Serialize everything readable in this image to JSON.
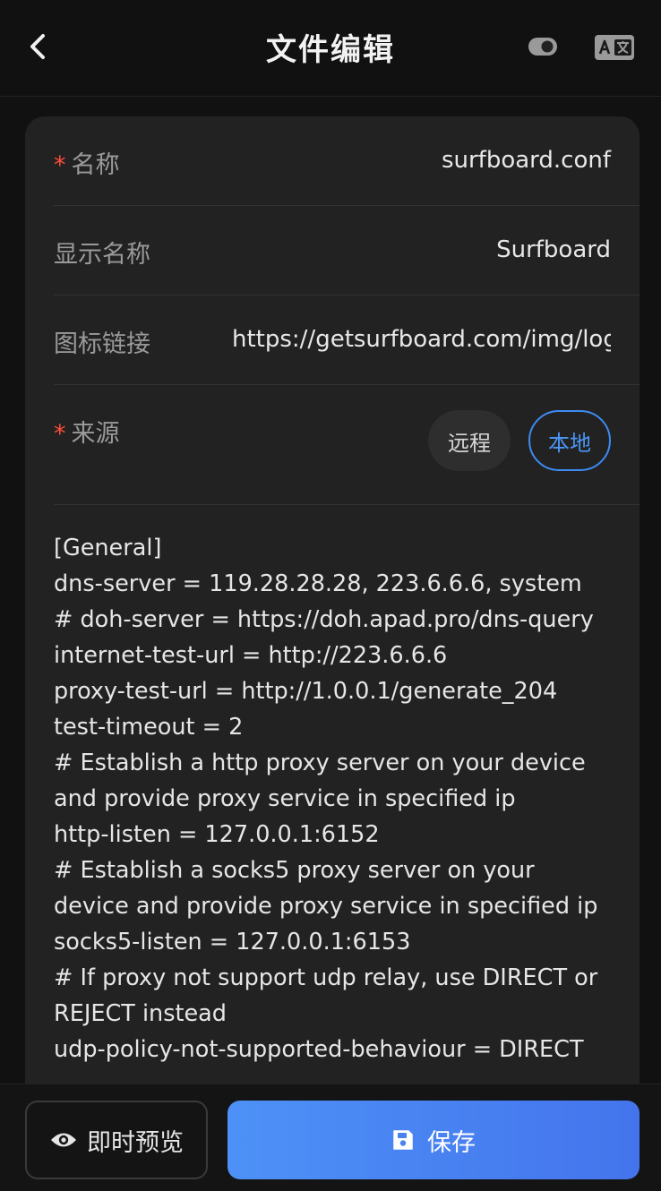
{
  "header": {
    "title": "文件编辑"
  },
  "form": {
    "name": {
      "label": "名称",
      "value": "surfboard.conf",
      "required": true
    },
    "display_name": {
      "label": "显示名称",
      "value": "Surfboard"
    },
    "icon_url": {
      "label": "图标链接",
      "value": "https://getsurfboard.com/img/logo."
    },
    "source": {
      "label": "来源",
      "required": true,
      "options": [
        "远程",
        "本地"
      ],
      "selected": "本地"
    }
  },
  "editor": {
    "content": "[General]\ndns-server = 119.28.28.28, 223.6.6.6, system\n# doh-server = https://doh.apad.pro/dns-query\ninternet-test-url = http://223.6.6.6\nproxy-test-url = http://1.0.0.1/generate_204\ntest-timeout = 2\n# Establish a http proxy server on your device and provide proxy service in specified ip\nhttp-listen = 127.0.0.1:6152\n# Establish a socks5 proxy server on your device and provide proxy service in specified ip\nsocks5-listen = 127.0.0.1:6153\n# If proxy not support udp relay, use DIRECT or REJECT instead\nudp-policy-not-supported-behaviour = DIRECT"
  },
  "actions": {
    "preview_label": "即时预览",
    "save_label": "保存"
  },
  "colors": {
    "accent": "#4d91f7",
    "required": "#ff4d3a",
    "background": "#111111",
    "card": "#222222"
  }
}
